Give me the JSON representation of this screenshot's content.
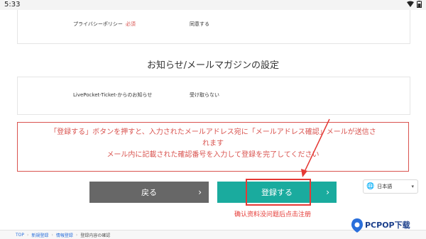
{
  "status_bar": {
    "time": "5:33",
    "icons": [
      "wifi-icon",
      "battery-icon"
    ]
  },
  "privacy": {
    "label": "プライバシーポリシー",
    "required": "必須",
    "value": "同意する"
  },
  "newsletter_section": {
    "title": "お知らせ/メールマガジンの設定"
  },
  "newsletter": {
    "label": "LivePocket-Ticket-からのお知らせ",
    "value": "受け取らない"
  },
  "notice": {
    "line1": "「登録する」ボタンを押すと、入力されたメールアドレス宛に「メールアドレス確認」メールが送信さ",
    "line2": "れます",
    "line3": "メール内に記載された確認番号を入力して登録を完了してください"
  },
  "buttons": {
    "back": "戻る",
    "register": "登録する"
  },
  "annotation": "确认资料没问题后点击注册",
  "language": {
    "selected": "日本語"
  },
  "breadcrumb": [
    "TOP",
    "新規登録",
    "情報登録",
    "登録内容の確認"
  ],
  "watermark": "PCPOP下载",
  "colors": {
    "accent": "#1aab9e",
    "back_button": "#676767",
    "notice": "#d9534f",
    "annotation": "#e53935"
  }
}
